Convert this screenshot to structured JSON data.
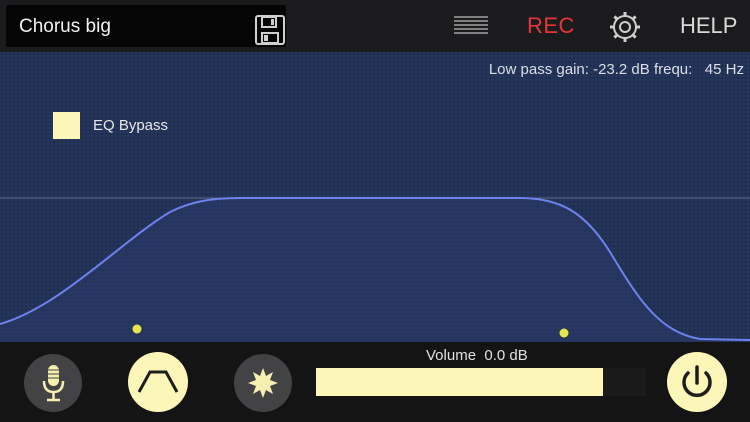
{
  "preset": {
    "name": "Chorus big"
  },
  "toolbar": {
    "rec_label": "REC",
    "help_label": "HELP"
  },
  "eq": {
    "readout": "Low pass gain: -23.2 dB frequ:   45 Hz",
    "bypass_label": "EQ Bypass"
  },
  "volume": {
    "label": "Volume  0.0 dB",
    "level": 0.87
  },
  "icons": {
    "save": "floppy-disk-icon",
    "menu": "menu-lines-icon",
    "settings": "gear-icon",
    "mic": "microphone-icon",
    "filter": "filter-shape-icon",
    "fx": "effects-burst-icon",
    "power": "power-icon"
  },
  "colors": {
    "accent": "#fcf7b8",
    "rec": "#e5343b",
    "curve": "#6e82ee",
    "eq_bg": "#24345a",
    "handle": "#e6e64c"
  }
}
